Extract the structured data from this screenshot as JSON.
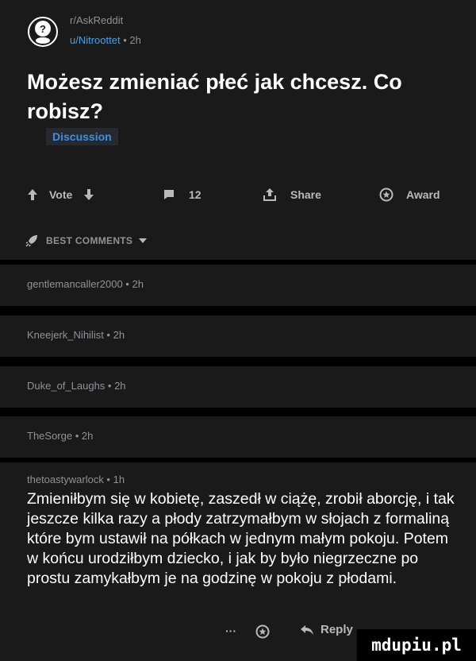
{
  "post": {
    "subreddit": "r/AskReddit",
    "author": "u/Nitroottet",
    "time_sep": " • ",
    "age": "2h",
    "title": "Możesz zmieniać płeć jak chcesz. Co robisz?",
    "flair": "Discussion"
  },
  "actions": {
    "vote_label": "Vote",
    "comments_count": "12",
    "share_label": "Share",
    "award_label": "Award"
  },
  "sort": {
    "label": "BEST COMMENTS"
  },
  "comments": [
    {
      "meta": "gentlemancaller2000 • 2h"
    },
    {
      "meta": "Kneejerk_Nihilist • 2h"
    },
    {
      "meta": "Duke_of_Laughs • 2h"
    },
    {
      "meta": "TheSorge • 2h"
    }
  ],
  "last_comment": {
    "meta": "thetoastywarlock • 1h",
    "body": "Zmieniłbym się w kobietę, zaszedł w ciążę, zrobił aborcję, i tak jeszcze kilka razy a płody zatrzymałbym w słojach z formaliną które bym ustawił na półkach w jednym małym pokoju. Potem w końcu urodziłbym dziecko, i jak by było niegrzeczne po prostu zamykałbym je na godzinę w pokoju z płodami.",
    "more": "···",
    "reply_label": "Reply"
  },
  "watermark": "mdupiu.pl",
  "colors": {
    "card": "#1a1a1b",
    "accent": "#4f9fe0",
    "muted": "#8f9297"
  }
}
